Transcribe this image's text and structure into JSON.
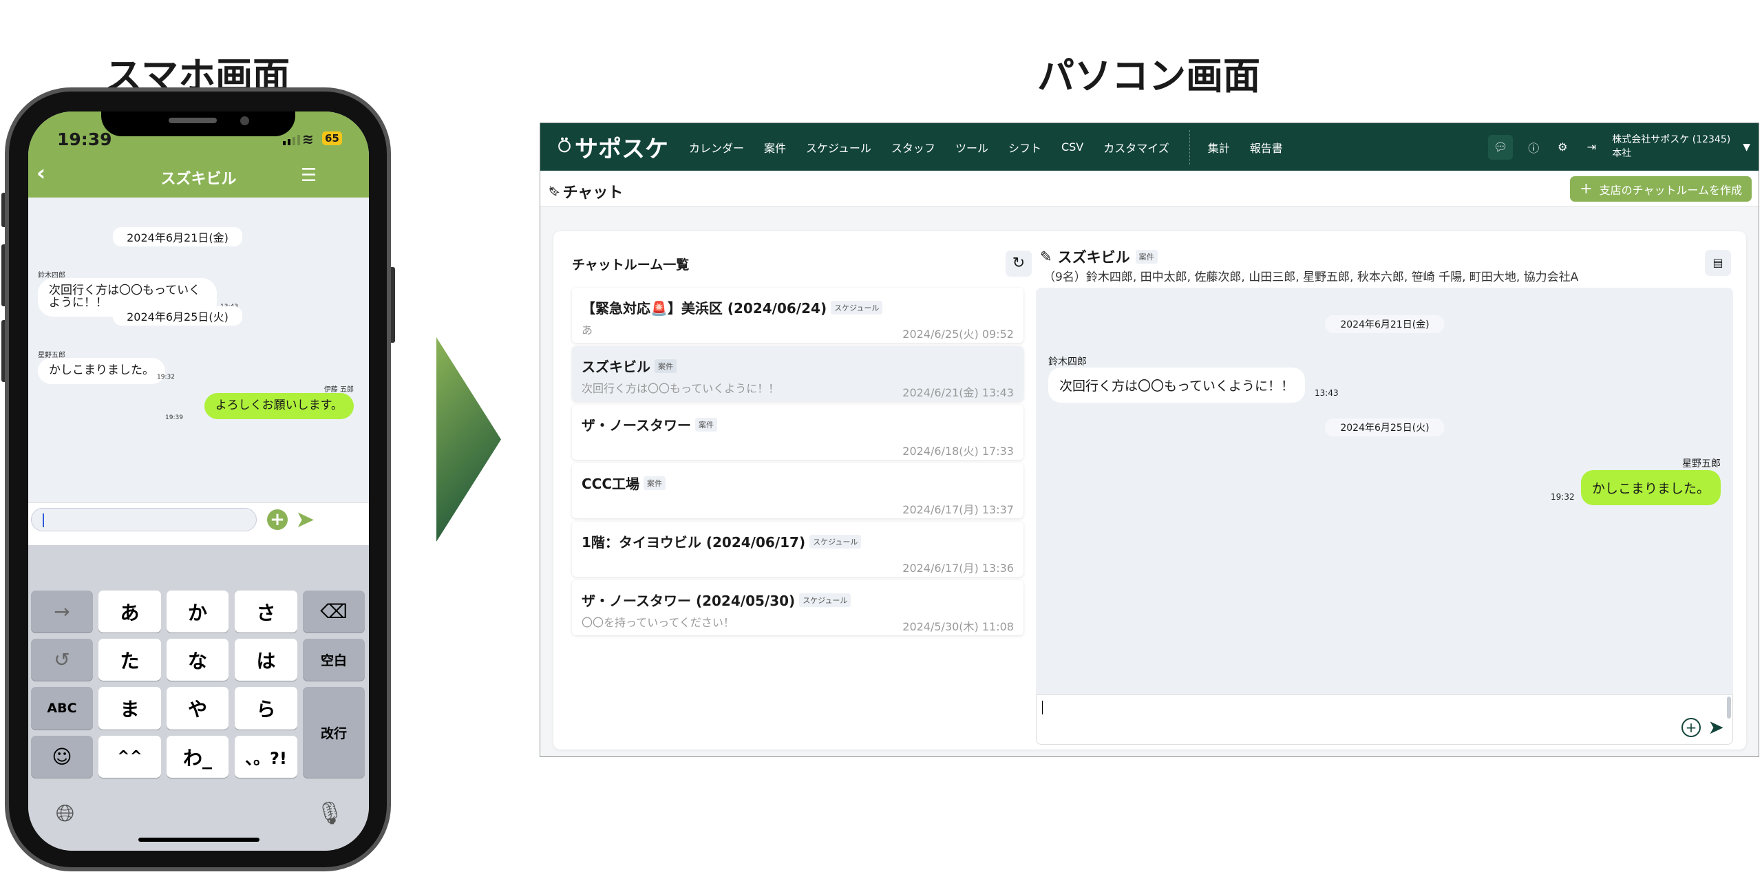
{
  "titles": {
    "phone": "スマホ画面",
    "pc": "パソコン画面"
  },
  "colors": {
    "brand_dark": "#12443a",
    "brand_green": "#8bb356",
    "my_bubble": "#aef03a"
  },
  "phone": {
    "status": {
      "time": "19:39",
      "battery": "65"
    },
    "header": {
      "title": "スズキビル",
      "back_icon": "chevron-left-icon",
      "menu_icon": "list-icon"
    },
    "messages": [
      {
        "type": "date",
        "text": "2024年6月21日(金)"
      },
      {
        "type": "msg",
        "sender": "鈴木四郎",
        "text": "次回行く方は〇〇もっていくように！！",
        "time": "13:43"
      },
      {
        "type": "date",
        "text": "2024年6月25日(火)"
      },
      {
        "type": "msg",
        "sender": "星野五郎",
        "text": "かしこまりました。",
        "time": "19:32"
      },
      {
        "type": "mine",
        "sender": "伊藤 五郎",
        "text": "よろしくお願いします。",
        "time": "19:39"
      }
    ],
    "keyboard": {
      "keys": [
        "→",
        "あ",
        "か",
        "さ",
        "⌫",
        "↺",
        "た",
        "な",
        "は",
        "空白",
        "ABC",
        "ま",
        "や",
        "ら",
        "改行",
        "☺",
        "^^",
        "わ_",
        "、。?!"
      ]
    }
  },
  "pc": {
    "logo": "サポスケ",
    "nav": [
      "カレンダー",
      "案件",
      "スケジュール",
      "スタッフ",
      "ツール",
      "シフト",
      "CSV",
      "カスタマイズ"
    ],
    "nav2": [
      "集計",
      "報告書"
    ],
    "company": "株式会社サポスケ (12345)",
    "branch": "本社",
    "page_title": "チャット",
    "create_button": "支店のチャットルームを作成",
    "room_list_title": "チャットルーム一覧",
    "rooms": [
      {
        "title": "【緊急対応🚨】美浜区 (2024/06/24)",
        "tag": "スケジュール",
        "preview": "あ",
        "date": "2024/6/25(火) 09:52"
      },
      {
        "title": "スズキビル",
        "tag": "案件",
        "preview": "次回行く方は〇〇もっていくように！！",
        "date": "2024/6/21(金) 13:43",
        "selected": true
      },
      {
        "title": "ザ・ノースタワー",
        "tag": "案件",
        "preview": "",
        "date": "2024/6/18(火) 17:33"
      },
      {
        "title": "CCC工場",
        "tag": "案件",
        "preview": "",
        "date": "2024/6/17(月) 13:37"
      },
      {
        "title": "1階：タイヨウビル (2024/06/17)",
        "tag": "スケジュール",
        "preview": "",
        "date": "2024/6/17(月) 13:36"
      },
      {
        "title": "ザ・ノースタワー (2024/05/30)",
        "tag": "スケジュール",
        "preview": "〇〇を持っていってください！",
        "date": "2024/5/30(木) 11:08"
      }
    ],
    "chat": {
      "title": "スズキビル",
      "tag": "案件",
      "members": "（9名）鈴木四郎, 田中太郎, 佐藤次郎, 山田三郎, 星野五郎, 秋本六郎, 笹崎 千陽, 町田大地, 協力会社A",
      "date1": "2024年6月21日(金)",
      "msg1": {
        "sender": "鈴木四郎",
        "text": "次回行く方は〇〇もっていくように！！",
        "time": "13:43"
      },
      "date2": "2024年6月25日(火)",
      "msg2": {
        "sender": "星野五郎",
        "text": "かしこまりました。",
        "time": "19:32"
      },
      "input_value": ""
    }
  }
}
